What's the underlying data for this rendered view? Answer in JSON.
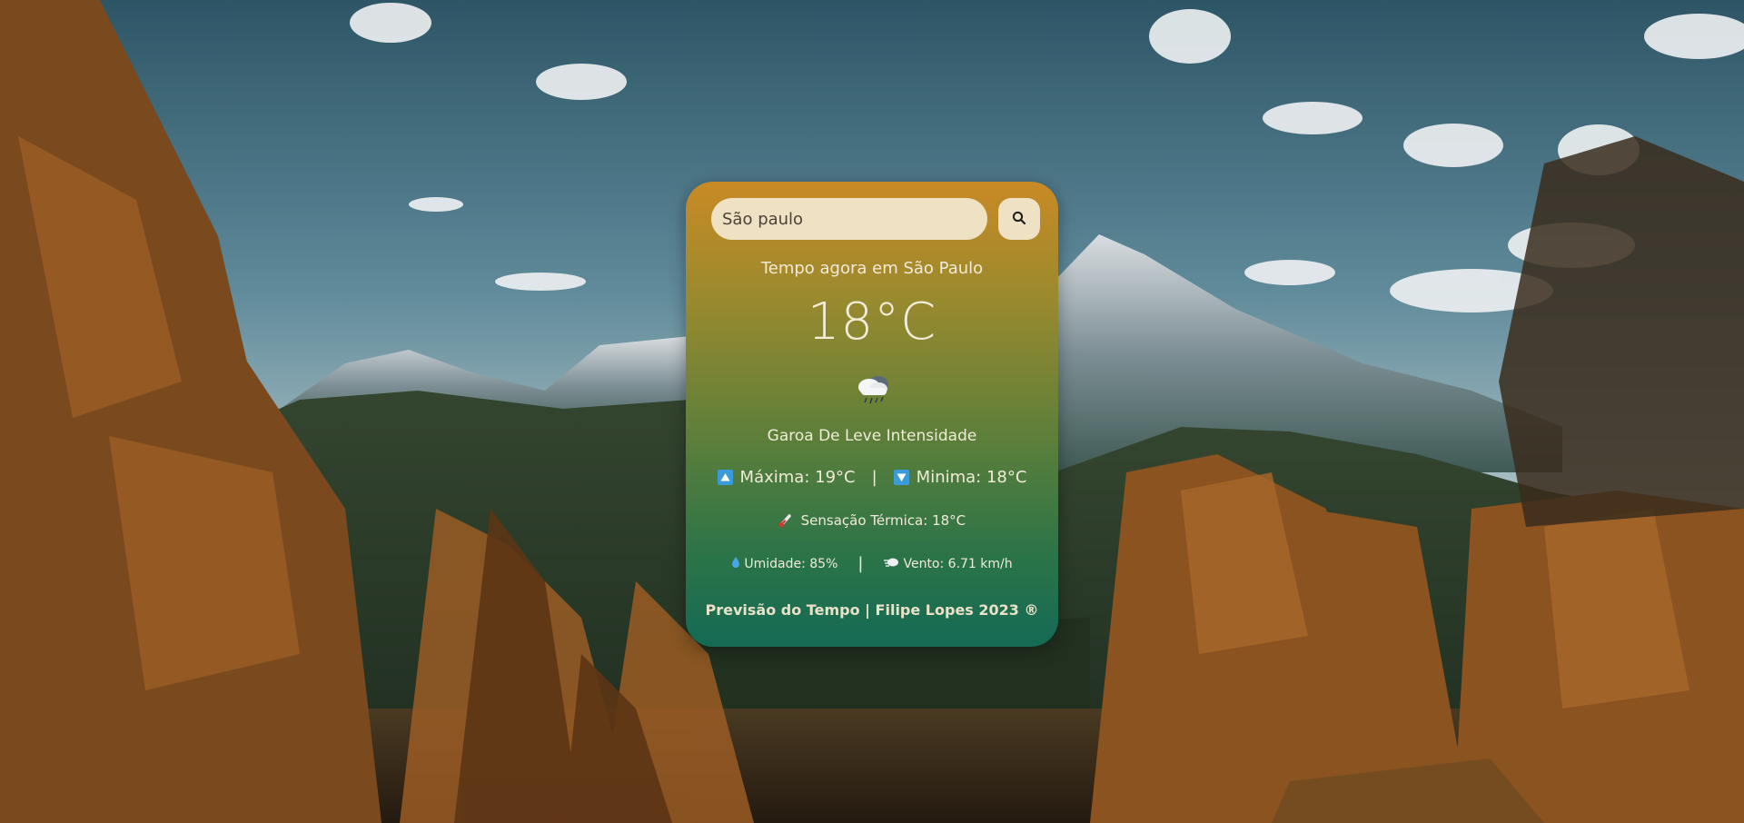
{
  "search": {
    "value": "São paulo",
    "button_icon": "search-icon"
  },
  "weather": {
    "city_line": "Tempo agora em São Paulo",
    "temperature": "18°C",
    "condition_icon": "cloud-rain-icon",
    "description": "Garoa De Leve Intensidade",
    "max_label": "Máxima: 19°C",
    "min_label": "Minima: 18°C",
    "separator": "|",
    "feels_like": "Sensação Térmica: 18°C",
    "humidity": "Umidade: 85%",
    "wind": "Vento: 6.71 km/h"
  },
  "footer": {
    "text": "Previsão do Tempo | Filipe Lopes 2023 ®"
  },
  "colors": {
    "card_top": "#c98a25",
    "card_bottom": "#146a55",
    "input_bg": "#efe1c3",
    "arrow_box": "#3b9bd8",
    "text": "#f1ead8"
  }
}
